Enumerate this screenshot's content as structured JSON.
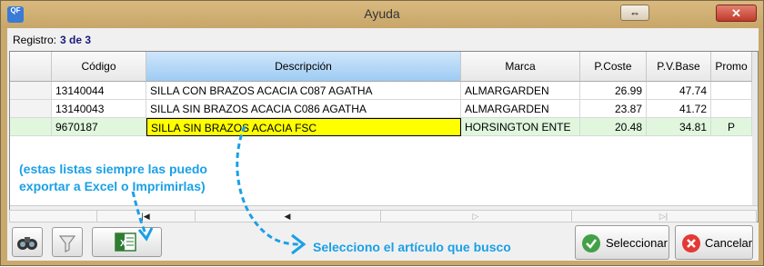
{
  "window": {
    "title": "Ayuda",
    "app_icon_text": "QF"
  },
  "record": {
    "label": "Registro:",
    "value": "3 de 3"
  },
  "table": {
    "columns": [
      "Código",
      "Descripción",
      "Marca",
      "P.Coste",
      "P.V.Base",
      "Promo"
    ],
    "rows": [
      {
        "codigo": "13140044",
        "descripcion": "SILLA CON BRAZOS ACACIA C087 AGATHA",
        "marca": "ALMARGARDEN",
        "coste": "26.99",
        "pvbase": "47.74",
        "promo": ""
      },
      {
        "codigo": "13140043",
        "descripcion": "SILLA SIN BRAZOS ACACIA C086 AGATHA",
        "marca": "ALMARGARDEN",
        "coste": "23.87",
        "pvbase": "41.72",
        "promo": ""
      },
      {
        "codigo": "9670187",
        "descripcion": "SILLA SIN BRAZOS ACACIA FSC",
        "marca": "HORSINGTON ENTE",
        "coste": "20.48",
        "pvbase": "34.81",
        "promo": "P"
      }
    ]
  },
  "buttons": {
    "select": "Seleccionar",
    "cancel": "Cancelar"
  },
  "annotations": {
    "export_note_line1": "(estas listas siempre las puedo",
    "export_note_line2": "exportar a Excel o Imprimirlas)",
    "select_note": "Selecciono el artículo que busco"
  },
  "colors": {
    "annotation": "#1aa0e6",
    "selected_row": "#e0f7de",
    "focused_cell": "#ffff00",
    "window_frame": "#c9a96e"
  }
}
